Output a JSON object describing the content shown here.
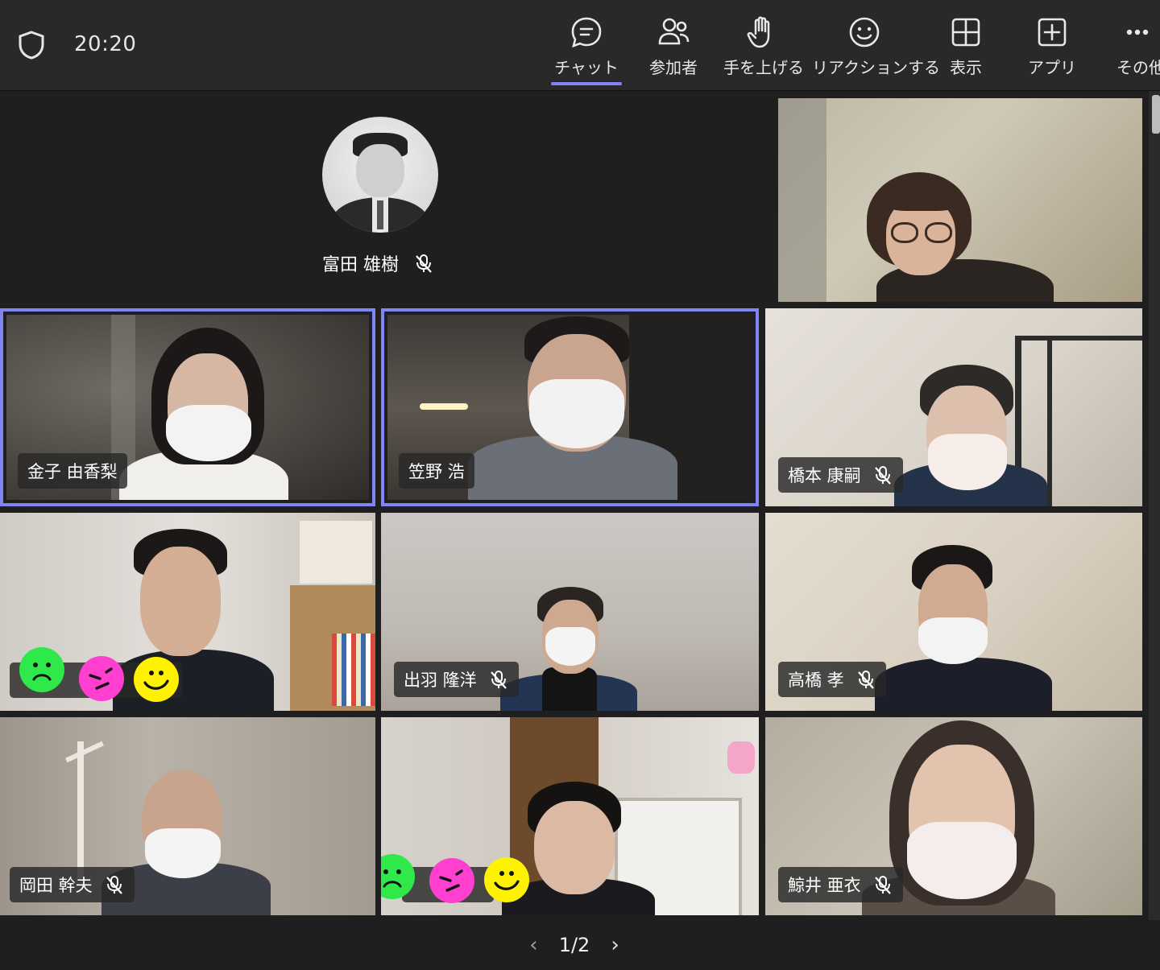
{
  "header": {
    "time": "20:20",
    "toolbar": [
      {
        "label": "チャット",
        "icon": "chat-icon",
        "active": true
      },
      {
        "label": "参加者",
        "icon": "people-icon"
      },
      {
        "label": "手を上げる",
        "icon": "raise-hand-icon"
      },
      {
        "label": "リアクションする",
        "icon": "reaction-icon"
      },
      {
        "label": "表示",
        "icon": "view-grid-icon"
      },
      {
        "label": "アプリ",
        "icon": "apps-add-icon"
      },
      {
        "label": "その他",
        "icon": "more-icon"
      }
    ],
    "accent": "#7f85f5"
  },
  "participants": {
    "avatar": {
      "name": "富田 雄樹",
      "muted": true
    },
    "p2": {
      "name": "",
      "muted": false
    },
    "p3": {
      "name": "金子 由香梨",
      "muted": false,
      "speaking": true
    },
    "p4": {
      "name": "笠野 浩",
      "muted": false,
      "speaking": true
    },
    "p5": {
      "name": "橋本 康嗣",
      "muted": true
    },
    "p6": {
      "name": "",
      "muted": false
    },
    "p7": {
      "name": "出羽 隆洋",
      "muted": true
    },
    "p8": {
      "name": "高橋 孝",
      "muted": true
    },
    "p9": {
      "name": "岡田 幹夫",
      "muted": true
    },
    "p10": {
      "name": "",
      "muted": false
    },
    "p11": {
      "name": "鯨井 亜衣",
      "muted": true
    }
  },
  "pager": {
    "label": "1/2",
    "prev": "‹",
    "next": "›"
  }
}
